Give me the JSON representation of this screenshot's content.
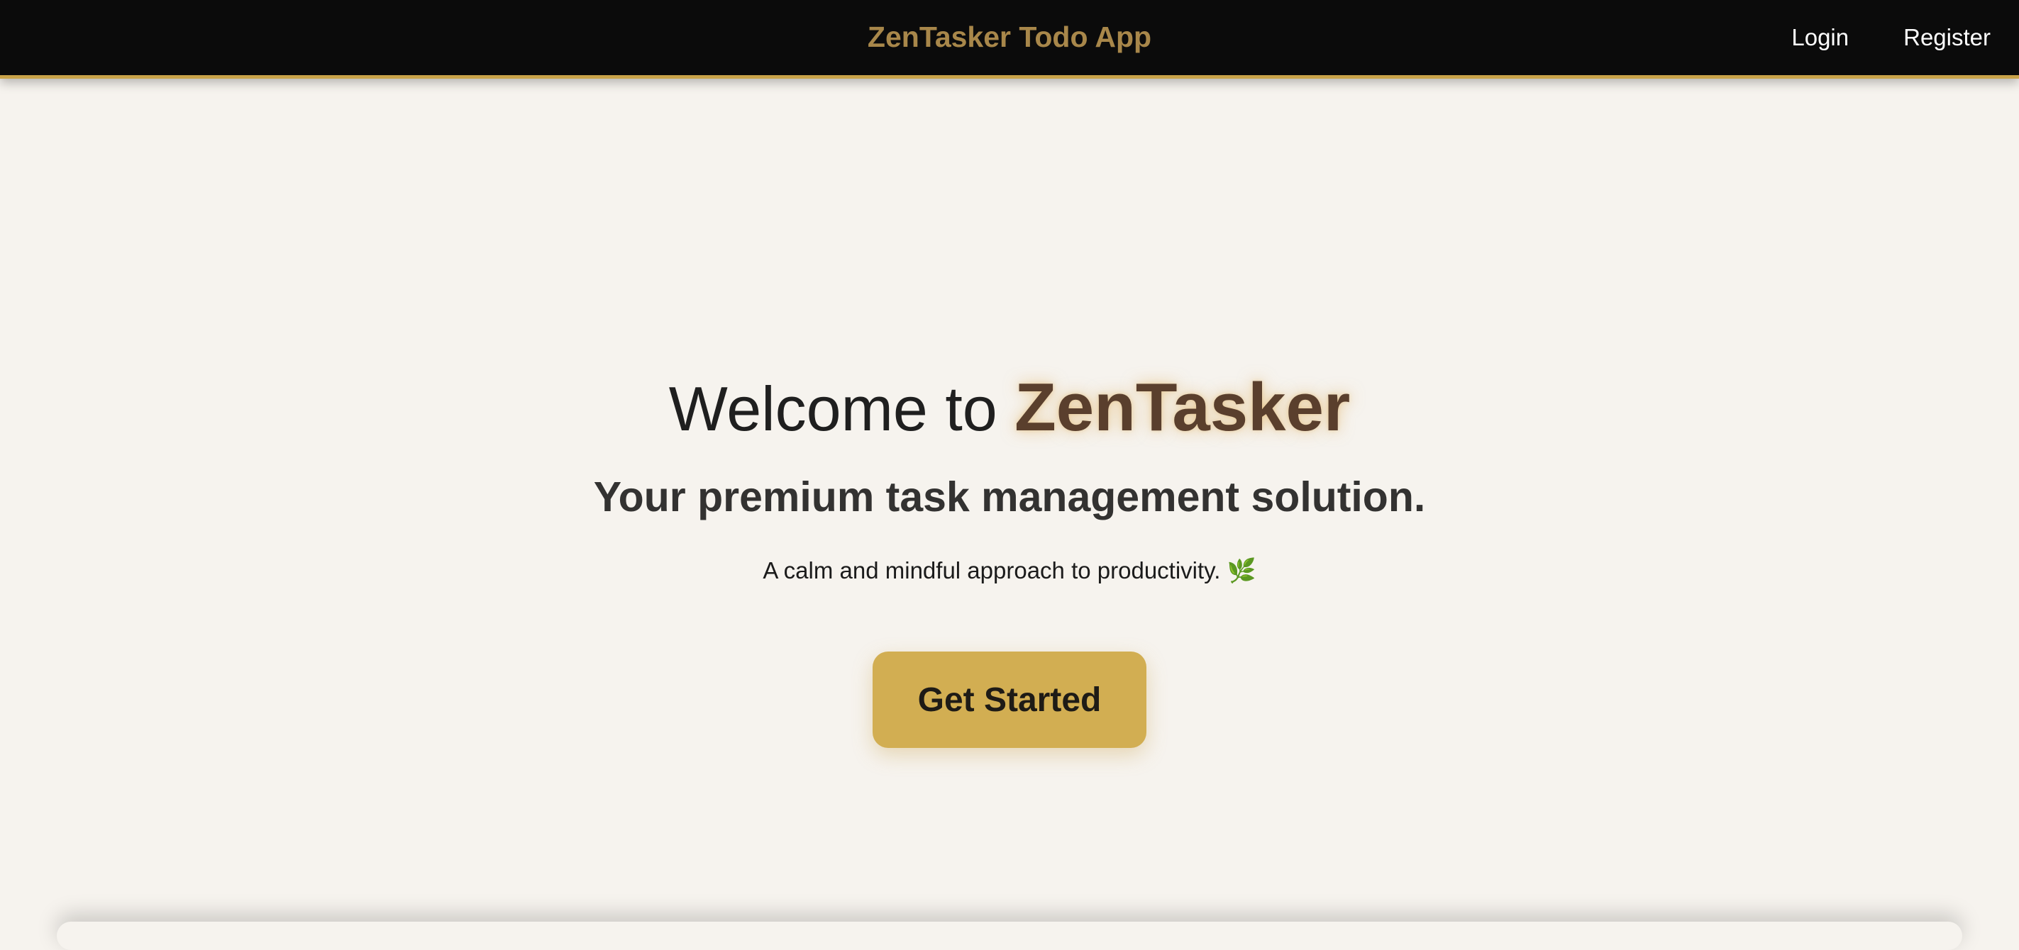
{
  "navbar": {
    "brand": "ZenTasker Todo App",
    "links": [
      {
        "label": "Login"
      },
      {
        "label": "Register"
      }
    ]
  },
  "hero": {
    "title_prefix": "Welcome to ",
    "title_brand": "ZenTasker",
    "subtitle": "Your premium task management solution.",
    "description": "A calm and mindful approach to productivity.",
    "description_icon": "🌿",
    "cta_label": "Get Started"
  },
  "colors": {
    "navbar_bg": "#0b0b0b",
    "brand_gold": "#a8874a",
    "accent_gold": "#d2ae52",
    "page_bg": "#f6f3ee",
    "hero_brand": "#5a3f2d"
  }
}
